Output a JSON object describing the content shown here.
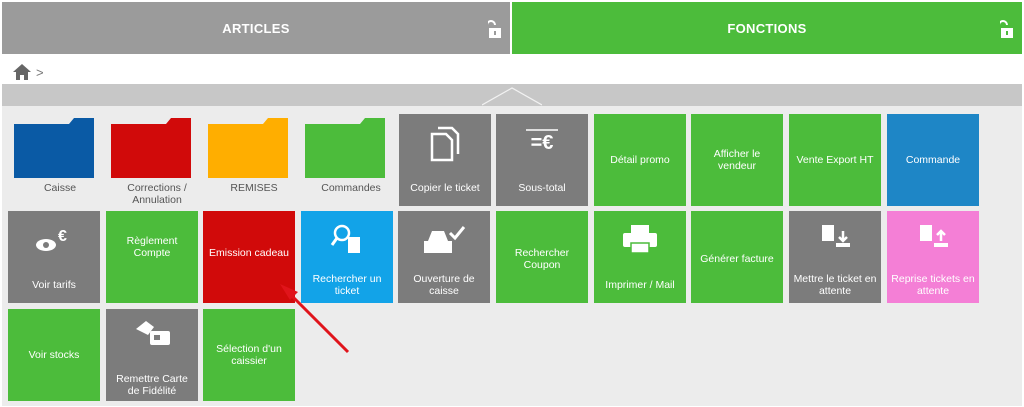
{
  "tabs": {
    "articles": "ARTICLES",
    "fonctions": "FONCTIONS"
  },
  "breadcrumb": {
    "separator": ">"
  },
  "tiles": {
    "caisse": "Caisse",
    "corrections": "Corrections / Annulation",
    "remises": "REMISES",
    "commandes": "Commandes",
    "copier": "Copier le ticket",
    "soustotal": "Sous-total",
    "soustotal_icon": "=€",
    "detail_promo": "Détail promo",
    "afficher_vendeur": "Afficher le vendeur",
    "vente_export": "Vente Export HT",
    "commande": "Commande",
    "voir_tarifs": "Voir tarifs",
    "reglement_compte": "Règlement Compte",
    "emission_cadeau": "Emission cadeau",
    "rechercher_ticket": "Rechercher un ticket",
    "ouverture_caisse": "Ouverture de caisse",
    "rechercher_coupon": "Rechercher Coupon",
    "imprimer_mail": "Imprimer / Mail",
    "generer_facture": "Générer facture",
    "mettre_attente": "Mettre le ticket en attente",
    "reprise_attente": "Reprise tickets en attente",
    "voir_stocks": "Voir stocks",
    "remettre_carte": "Remettre Carte de Fidélité",
    "selection_caissier": "Sélection d'un caissier"
  },
  "colors": {
    "green": "#4cbc3b",
    "grey": "#7c7c7c",
    "blue": "#1e86c6",
    "light_blue": "#12a3e8",
    "red": "#d10a0a",
    "pink": "#f47fd6",
    "folder_blue": "#0a5aa5",
    "folder_red": "#d10a0a",
    "folder_orange": "#ffae00",
    "folder_green": "#4cbc3b"
  }
}
